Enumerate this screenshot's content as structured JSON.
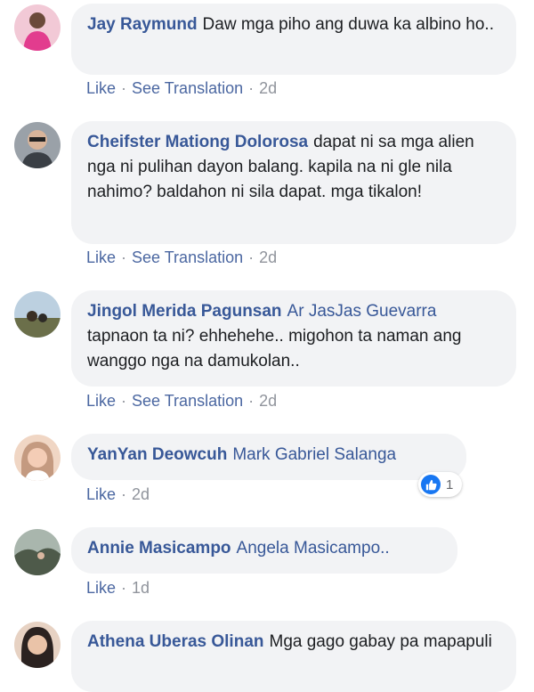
{
  "comments": [
    {
      "author": "Jay Raymund",
      "mention": "",
      "text": "Daw mga piho ang duwa ka albino ho..",
      "like_label": "Like",
      "translate_label": "See Translation",
      "time": "2d",
      "avatar_colors": [
        "#f2c9d6",
        "#e23c8e"
      ]
    },
    {
      "author": "Cheifster Mationg Dolorosa",
      "mention": "",
      "text": "dapat ni sa mga alien nga ni pulihan dayon balang. kapila na ni gle nila nahimo? baldahon ni sila dapat. mga tikalon!",
      "like_label": "Like",
      "translate_label": "See Translation",
      "time": "2d",
      "avatar_colors": [
        "#9aa1a8",
        "#3a3f45"
      ]
    },
    {
      "author": "Jingol Merida Pagunsan",
      "mention": "Ar JasJas Guevarra",
      "text": "tapnaon ta ni? ehhehehe.. migohon ta naman ang wanggo nga na damukolan..",
      "like_label": "Like",
      "translate_label": "See Translation",
      "time": "2d",
      "avatar_colors": [
        "#bcd0e0",
        "#6b6f4a"
      ]
    },
    {
      "author": "YanYan Deowcuh",
      "mention": "Mark Gabriel Salanga",
      "text": "",
      "like_label": "Like",
      "translate_label": "",
      "time": "2d",
      "reaction_count": "1",
      "avatar_colors": [
        "#f0d6c4",
        "#c49a80"
      ]
    },
    {
      "author": "Annie Masicampo",
      "mention": "Angela Masicampo..",
      "text": "",
      "like_label": "Like",
      "translate_label": "",
      "time": "1d",
      "avatar_colors": [
        "#a9b6ad",
        "#4e5a4a"
      ]
    },
    {
      "author": "Athena Uberas Olinan",
      "mention": "",
      "text": "Mga gago gabay pa mapapuli",
      "avatar_colors": [
        "#e7d2c3",
        "#2b2220"
      ]
    }
  ]
}
